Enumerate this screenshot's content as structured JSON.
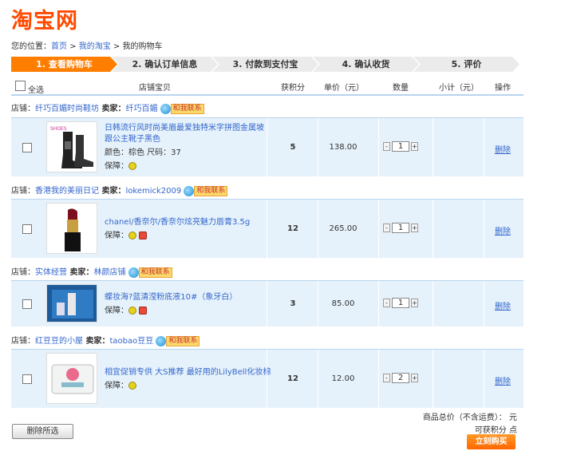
{
  "logo": "淘宝网",
  "breadcrumb": {
    "prefix": "您的位置：",
    "home": "首页",
    "sep1": " > ",
    "mytaobao": "我的淘宝",
    "sep2": " > ",
    "current": "我的购物车"
  },
  "steps": [
    "1. 查看购物车",
    "2. 确认订单信息",
    "3. 付款到支付宝",
    "4. 确认收货",
    "5. 评价"
  ],
  "header": {
    "select_all": "全选",
    "item": "店铺宝贝",
    "points": "获积分",
    "price": "单价（元）",
    "qty": "数量",
    "subtotal": "小计（元）",
    "action": "操作"
  },
  "contact_tag": "和我联系",
  "shops": [
    {
      "shop_label": "店铺：",
      "shop": "纤巧百媚时尚鞋坊",
      "seller_label": " 卖家：",
      "seller": "纤巧百媚",
      "item": {
        "title": "日韩流行风时尚美眉最爱独特米字拼图金属坡跟公主靴子黑色",
        "attr1": "颜色：棕色 尺码：37",
        "guarantee": "保障：",
        "points": "5",
        "price": "138.00",
        "qty": "1",
        "delete": "删除"
      }
    },
    {
      "shop_label": "店铺：",
      "shop": "香港我的美丽日记",
      "seller_label": " 卖家：",
      "seller": "lokemick2009",
      "item": {
        "title": "chanel/香奈尔/香奈尔炫亮魅力唇膏3.5g",
        "guarantee": "保障：",
        "points": "12",
        "price": "265.00",
        "qty": "1",
        "delete": "删除"
      }
    },
    {
      "shop_label": "店铺：",
      "shop": "实体经营",
      "seller_label": " 卖家：",
      "seller": "林颜店铺",
      "item": {
        "title": "蝶妆海?蓝清滢粉底液10#（象牙白）",
        "guarantee": "保障：",
        "points": "3",
        "price": "85.00",
        "qty": "1",
        "delete": "删除"
      }
    },
    {
      "shop_label": "店铺：",
      "shop": "红豆豆的小屋",
      "seller_label": " 卖家：",
      "seller": "taobao豆豆",
      "item": {
        "title": "相宜促销专供 大S推荐 最好用的LilyBell化妆棉",
        "guarantee": "保障：",
        "points": "12",
        "price": "12.00",
        "qty": "2",
        "delete": "删除"
      }
    }
  ],
  "summary": {
    "total": "商品总价（不含运费）： 元",
    "points": "可获积分 点"
  },
  "buttons": {
    "delete_selected": "删除所选",
    "buy_now": "立刻购买"
  }
}
